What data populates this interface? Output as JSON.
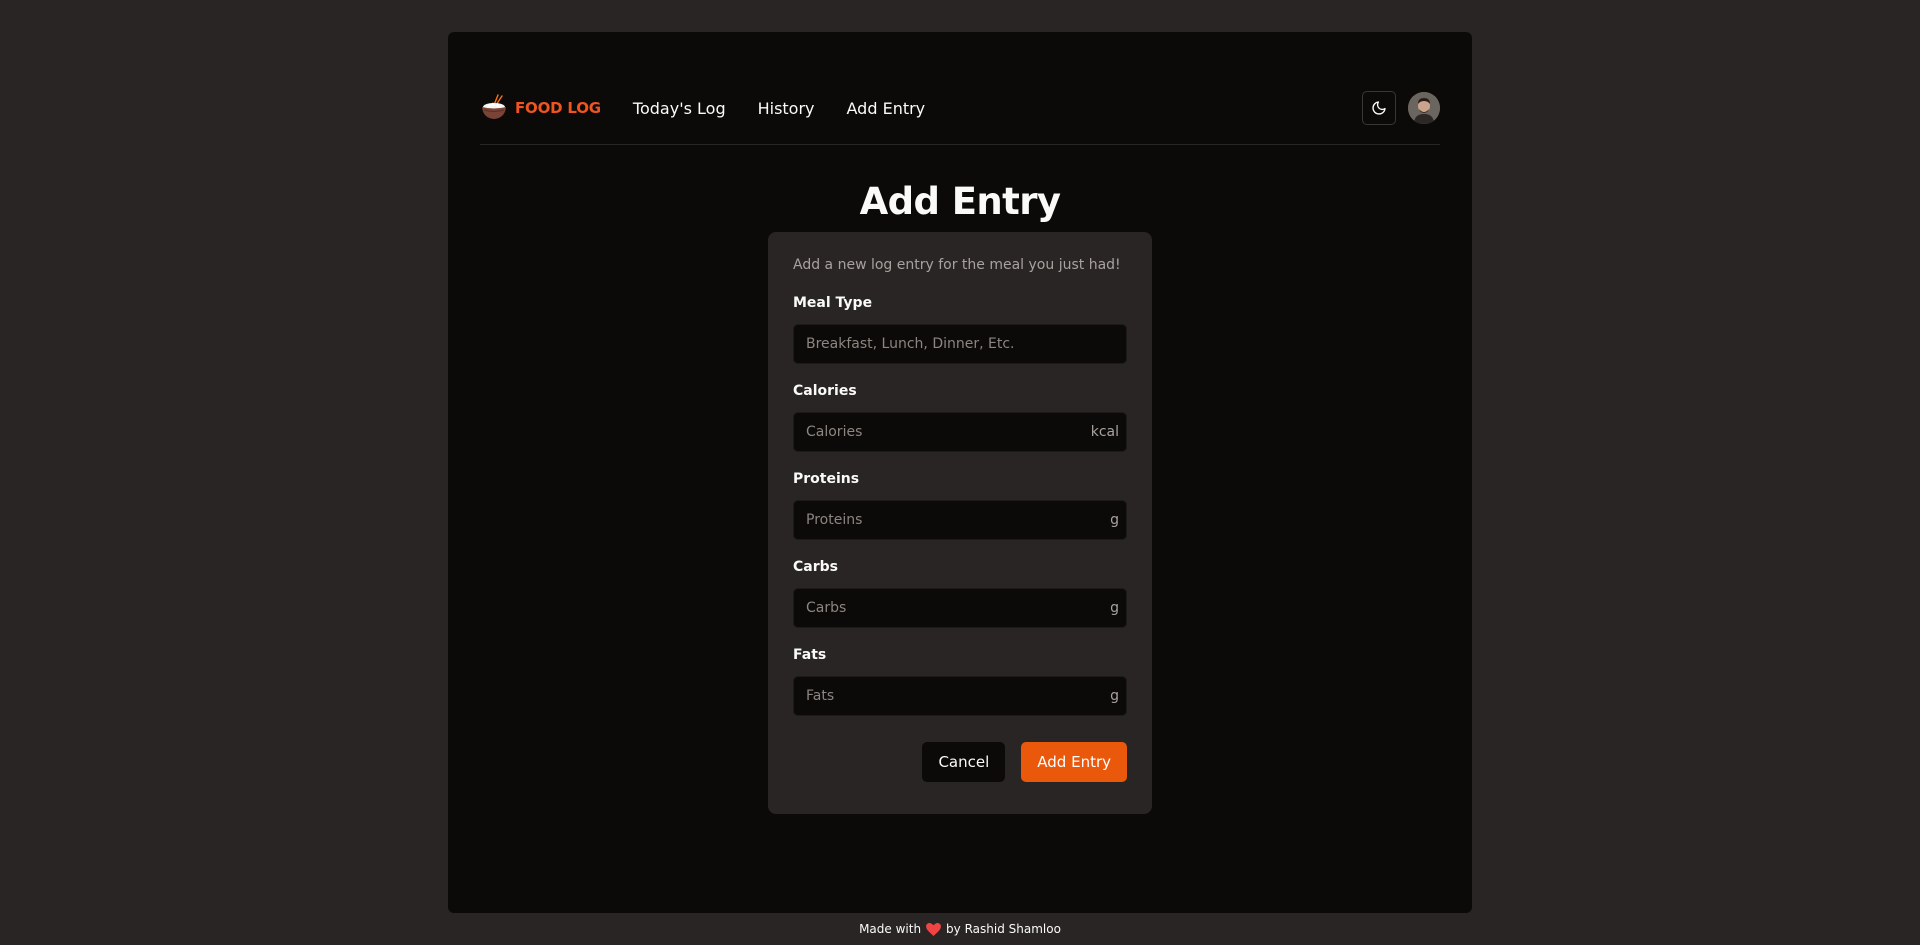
{
  "nav": {
    "brand": "FOOD LOG",
    "links": [
      "Today's Log",
      "History",
      "Add Entry"
    ]
  },
  "icons": {
    "brand": "rice-bowl-icon",
    "theme": "moon-icon",
    "footer": "heart-icon"
  },
  "colors": {
    "accent": "#ea580c",
    "brand": "#f0541f",
    "background": "#292524",
    "panel": "#0c0a09"
  },
  "page": {
    "title": "Add Entry"
  },
  "form": {
    "description": "Add a new log entry for the meal you just had!",
    "fields": [
      {
        "label": "Meal Type",
        "placeholder": "Breakfast, Lunch, Dinner, Etc.",
        "value": "",
        "suffix": ""
      },
      {
        "label": "Calories",
        "placeholder": "Calories",
        "value": "",
        "suffix": "kcal"
      },
      {
        "label": "Proteins",
        "placeholder": "Proteins",
        "value": "",
        "suffix": "g"
      },
      {
        "label": "Carbs",
        "placeholder": "Carbs",
        "value": "",
        "suffix": "g"
      },
      {
        "label": "Fats",
        "placeholder": "Fats",
        "value": "",
        "suffix": "g"
      }
    ],
    "cancel_label": "Cancel",
    "submit_label": "Add Entry"
  },
  "footer": {
    "prefix": "Made with",
    "suffix": "by Rashid Shamloo"
  }
}
